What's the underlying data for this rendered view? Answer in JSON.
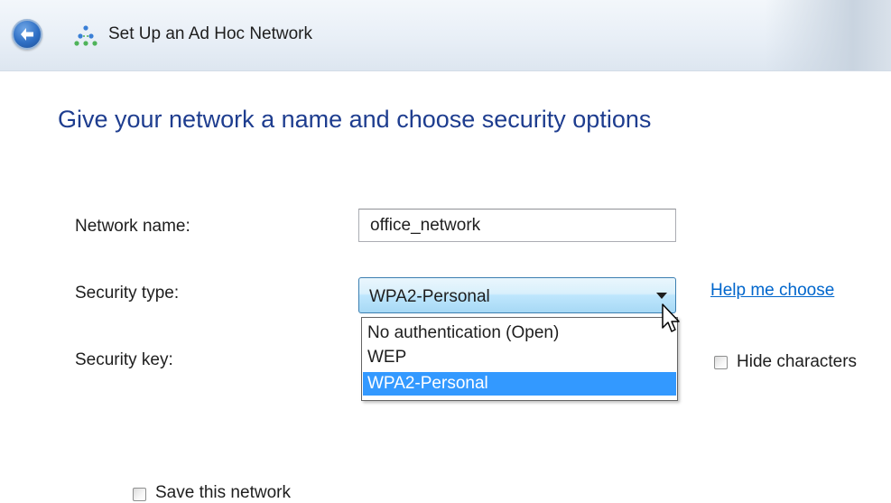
{
  "window": {
    "title": "Set Up an Ad Hoc Network",
    "back_icon": "back-arrow-icon",
    "app_icon": "network-icon"
  },
  "main": {
    "heading": "Give your network a name and choose security options",
    "network_name": {
      "label": "Network name:",
      "value": "office_network"
    },
    "security_type": {
      "label": "Security type:",
      "selected": "WPA2-Personal",
      "options": [
        "No authentication (Open)",
        "WEP",
        "WPA2-Personal"
      ],
      "help_link": "Help me choose"
    },
    "security_key": {
      "label": "Security key:"
    },
    "hide_characters": {
      "label": "Hide characters",
      "checked": false
    },
    "save_network": {
      "label": "Save this network",
      "checked": false
    }
  },
  "colors": {
    "heading": "#1e3d8f",
    "link": "#0066cc",
    "selection": "#3399ff"
  }
}
